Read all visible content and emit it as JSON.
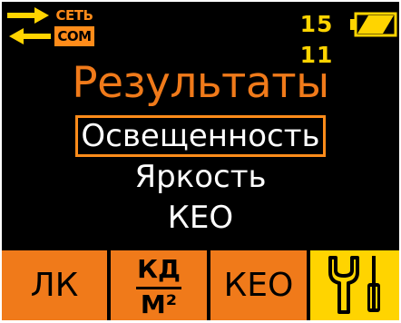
{
  "status": {
    "net_label_top": "СЕТЬ",
    "net_label_bottom": "COM",
    "clock": "15 11",
    "icons": {
      "transfer": "transfer-arrows-icon",
      "battery": "battery-icon"
    }
  },
  "screen": {
    "title": "Результаты",
    "menu": [
      {
        "label": "Освещенность",
        "selected": true
      },
      {
        "label": "Яркость",
        "selected": false
      },
      {
        "label": "КЕО",
        "selected": false
      }
    ]
  },
  "softkeys": {
    "lk": "ЛК",
    "cd_numerator": "КД",
    "cd_denominator": "М²",
    "keo": "КЕО",
    "settings_icon": "wrench-screwdriver-icon"
  },
  "colors": {
    "background": "#000000",
    "accent_orange": "#f07a1a",
    "accent_yellow": "#ffd400",
    "text": "#ffffff"
  }
}
